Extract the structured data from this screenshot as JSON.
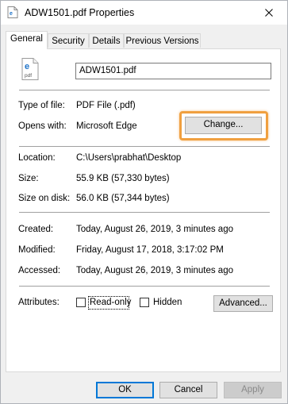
{
  "window": {
    "title": "ADW1501.pdf Properties",
    "close_icon": "close-icon"
  },
  "tabs": [
    {
      "label": "General",
      "active": true
    },
    {
      "label": "Security",
      "active": false
    },
    {
      "label": "Details",
      "active": false
    },
    {
      "label": "Previous Versions",
      "active": false
    }
  ],
  "general": {
    "file_icon": "pdf-edge-file-icon",
    "filename": "ADW1501.pdf",
    "type_of_file_label": "Type of file:",
    "type_of_file_value": "PDF File (.pdf)",
    "opens_with_label": "Opens with:",
    "opens_with_value": "Microsoft Edge",
    "change_button": "Change...",
    "location_label": "Location:",
    "location_value": "C:\\Users\\prabhat\\Desktop",
    "size_label": "Size:",
    "size_value": "55.9 KB (57,330 bytes)",
    "size_on_disk_label": "Size on disk:",
    "size_on_disk_value": "56.0 KB (57,344 bytes)",
    "created_label": "Created:",
    "created_value": "Today, August 26, 2019, 3 minutes ago",
    "modified_label": "Modified:",
    "modified_value": "Friday, August 17, 2018, 3:17:02 PM",
    "accessed_label": "Accessed:",
    "accessed_value": "Today, August 26, 2019, 3 minutes ago",
    "attributes_label": "Attributes:",
    "readonly_label": "Read-only",
    "readonly_checked": false,
    "hidden_label": "Hidden",
    "hidden_checked": false,
    "advanced_button": "Advanced..."
  },
  "footer": {
    "ok_button": "OK",
    "cancel_button": "Cancel",
    "apply_button": "Apply"
  },
  "colors": {
    "highlight": "#f0a040",
    "accent": "#0078d7",
    "edge_blue": "#1e73c8"
  }
}
